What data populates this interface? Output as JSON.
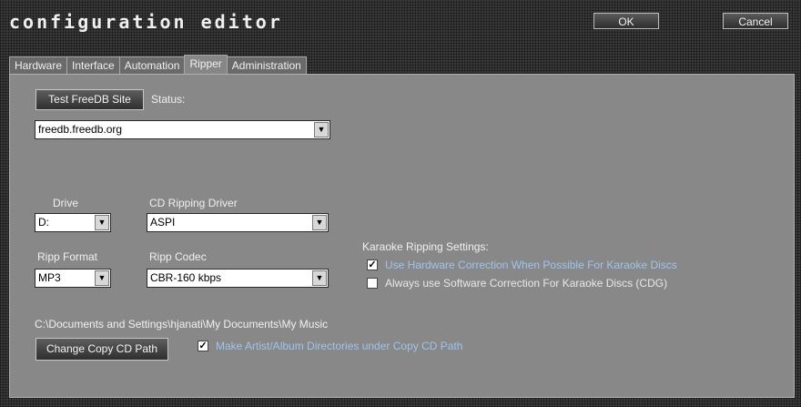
{
  "window": {
    "title": "configuration editor"
  },
  "toolbar": {
    "ok_label": "OK",
    "cancel_label": "Cancel"
  },
  "tabs": [
    "Hardware",
    "Interface",
    "Automation",
    "Ripper",
    "Administration"
  ],
  "active_tab": "Ripper",
  "freedb": {
    "test_button": "Test FreeDB Site",
    "status_label": "Status:",
    "server": "freedb.freedb.org"
  },
  "drive": {
    "label": "Drive",
    "value": "D:"
  },
  "ripping_driver": {
    "label": "CD Ripping Driver",
    "value": "ASPI"
  },
  "ripp_format": {
    "label": "Ripp Format",
    "value": "MP3"
  },
  "ripp_codec": {
    "label": "Ripp Codec",
    "value": "CBR-160 kbps"
  },
  "karaoke": {
    "heading": "Karaoke Ripping Settings:",
    "option1": {
      "label": "Use Hardware Correction When Possible For Karaoke Discs",
      "checked": true
    },
    "option2": {
      "label": "Always use Software Correction For Karaoke Discs (CDG)",
      "checked": false
    }
  },
  "copy_path": {
    "path": "C:\\Documents and Settings\\hjanati\\My Documents\\My Music",
    "change_button": "Change Copy CD Path",
    "make_dirs": {
      "label": "Make Artist/Album Directories under Copy CD Path",
      "checked": true
    }
  },
  "icons": {
    "dropdown": "chevron-down-icon",
    "check": "checkmark-icon"
  },
  "colors": {
    "accent_text": "#9fc4ee",
    "panel": "#888888",
    "chrome": "#3a3a3a"
  }
}
